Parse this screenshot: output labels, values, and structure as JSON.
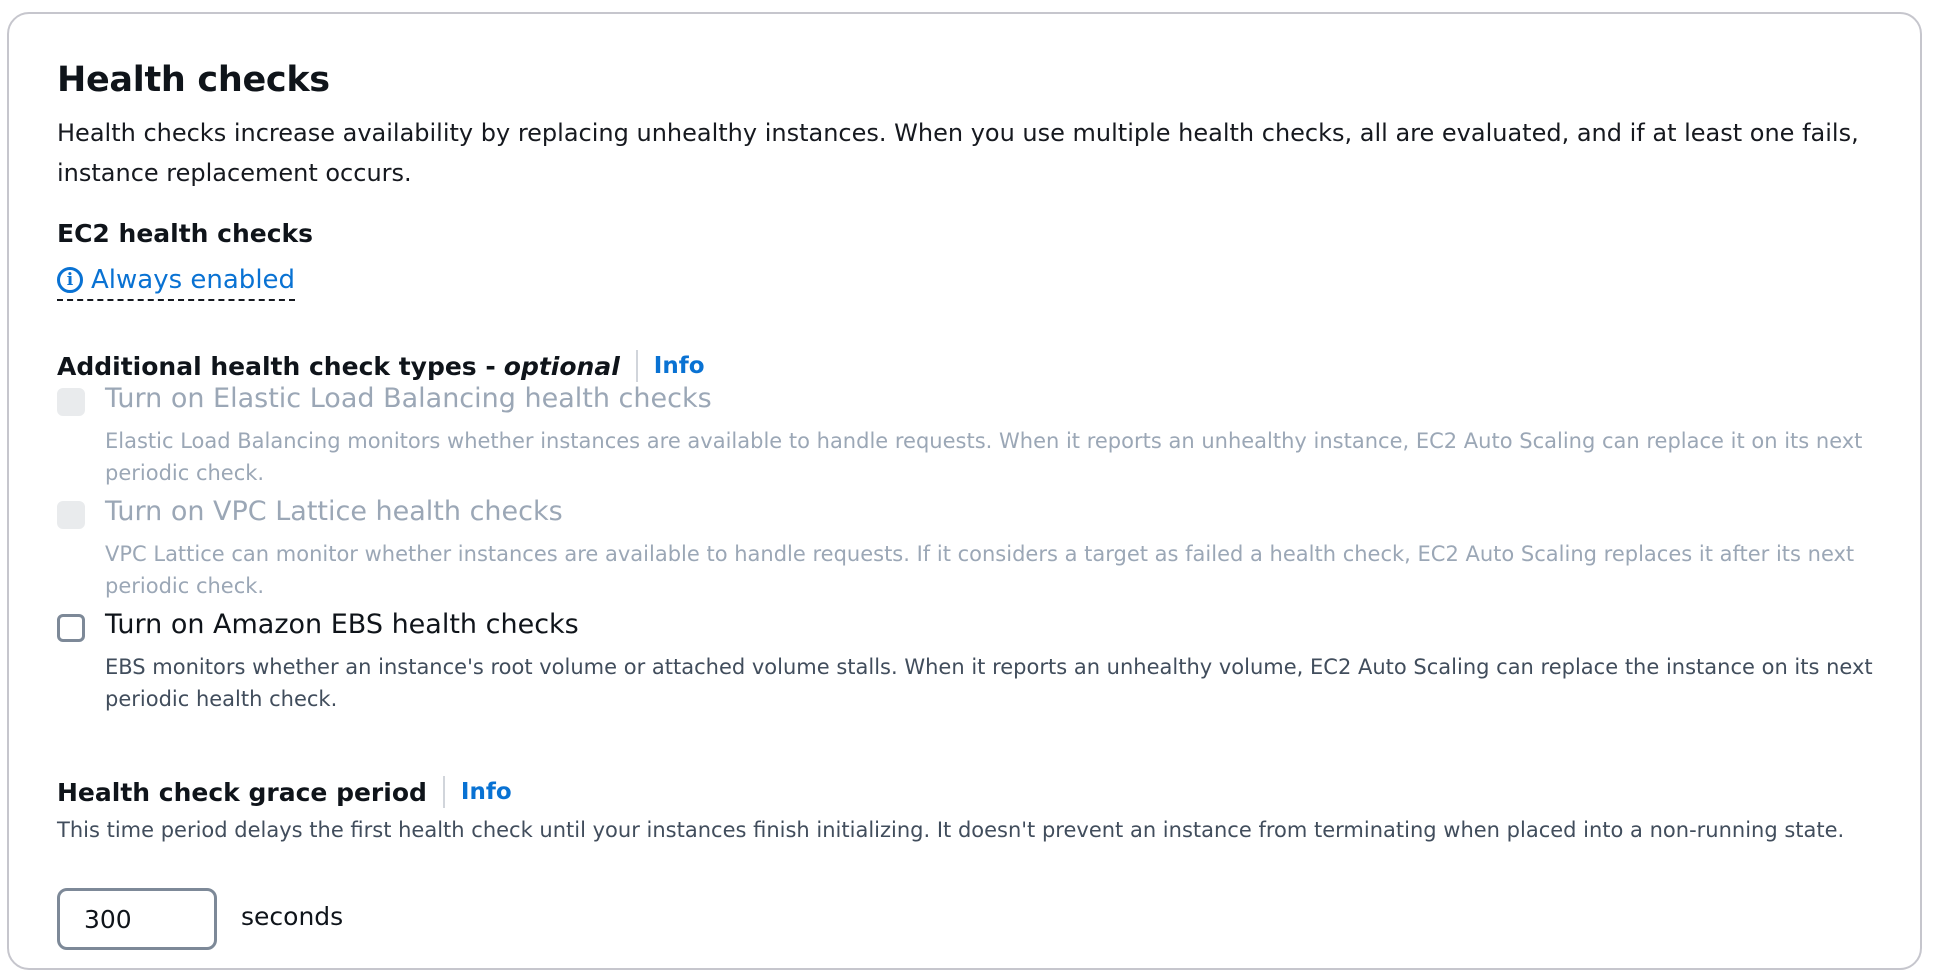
{
  "section": {
    "title": "Health checks",
    "description": "Health checks increase availability by replacing unhealthy instances. When you use multiple health checks, all are evaluated, and if at least one fails, instance replacement occurs."
  },
  "ec2": {
    "heading": "EC2 health checks",
    "status_icon": "info-icon",
    "status_label": "Always enabled"
  },
  "additional": {
    "heading": "Additional health check types -",
    "heading_optional": "optional",
    "info_label": "Info",
    "options": [
      {
        "label": "Turn on Elastic Load Balancing health checks",
        "description": "Elastic Load Balancing monitors whether instances are available to handle requests. When it reports an unhealthy instance, EC2 Auto Scaling can replace it on its next periodic check.",
        "checked": false,
        "disabled": true
      },
      {
        "label": "Turn on VPC Lattice health checks",
        "description": "VPC Lattice can monitor whether instances are available to handle requests. If it considers a target as failed a health check, EC2 Auto Scaling replaces it after its next periodic check.",
        "checked": false,
        "disabled": true
      },
      {
        "label": "Turn on Amazon EBS health checks",
        "description": "EBS monitors whether an instance's root volume or attached volume stalls. When it reports an unhealthy volume, EC2 Auto Scaling can replace the instance on its next periodic health check.",
        "checked": false,
        "disabled": false
      }
    ]
  },
  "grace": {
    "heading": "Health check grace period",
    "info_label": "Info",
    "description": "This time period delays the first health check until your instances finish initializing. It doesn't prevent an instance from terminating when placed into a non-running state.",
    "value": "300",
    "unit": "seconds"
  },
  "colors": {
    "link": "#0972d3",
    "text": "#0f141a",
    "disabled": "#9ba7b6",
    "border": "#c6c6cd"
  }
}
